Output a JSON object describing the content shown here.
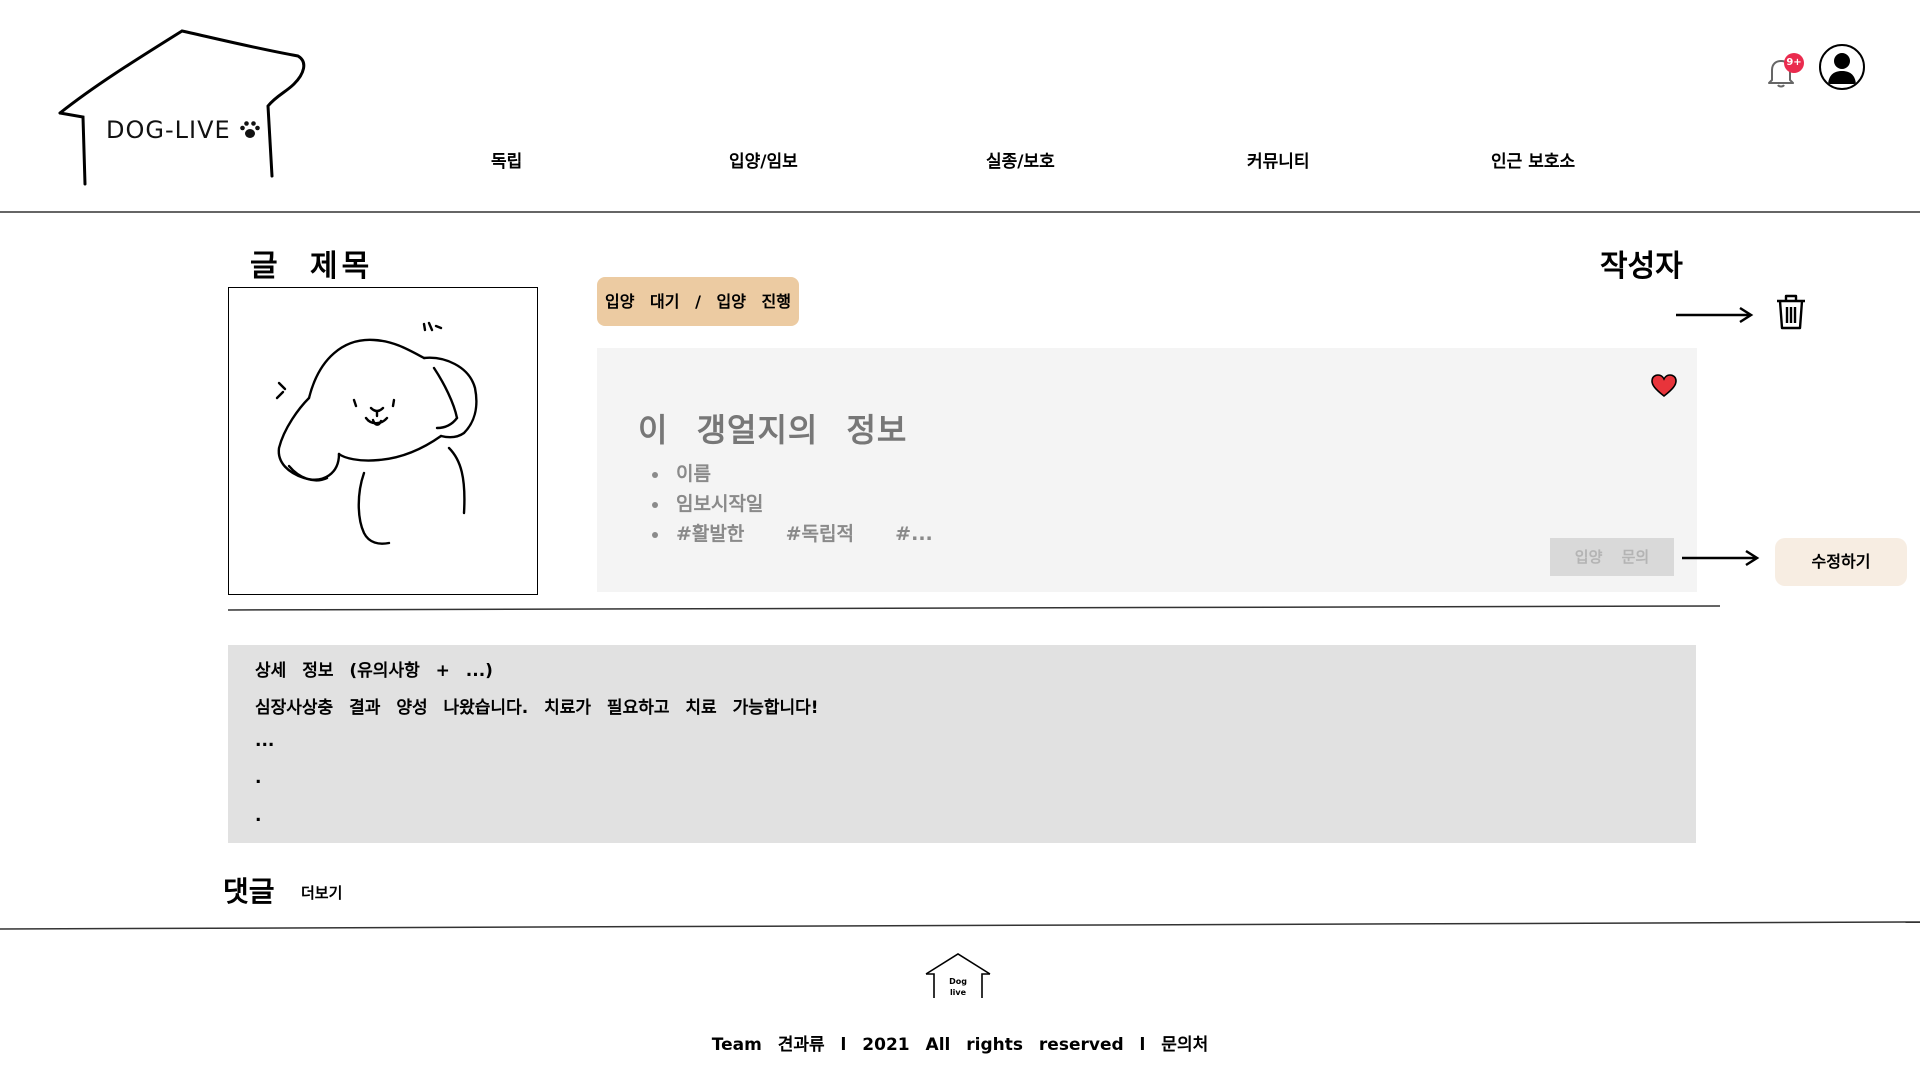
{
  "header": {
    "logo_text": "DOG-LIVE",
    "nav": [
      "독립",
      "입양/임보",
      "실종/보호",
      "커뮤니티",
      "인근 보호소"
    ],
    "notification_badge": "9+"
  },
  "post": {
    "title": "글 제목",
    "author": "작성자",
    "status": "입양 대기 / 입양 진행"
  },
  "info": {
    "heading": "이 갱얼지의 정보",
    "items": [
      "이름",
      "임보시작일",
      "#활발한  #독립적  #..."
    ],
    "inquiry_label": "입양 문의",
    "edit_label": "수정하기"
  },
  "detail": {
    "lines": [
      "상세 정보 (유의사항 + ...)",
      "심장사상충 결과 양성 나왔습니다. 치료가 필요하고 치료 가능합니다!",
      "...",
      ".",
      "."
    ]
  },
  "comments": {
    "label": "댓글",
    "more": "더보기"
  },
  "footer": {
    "logo_text_1": "Dog",
    "logo_text_2": "live",
    "text": "Team 견과류 l 2021 All rights reserved l 문의처"
  },
  "colors": {
    "status_badge": "#eccba2",
    "info_card": "#f4f4f4",
    "detail_box": "#e1e1e1",
    "edit_button": "#f7ede2",
    "heart": "#e8343b",
    "badge": "#ea2b4e"
  },
  "icons": [
    "paw-icon",
    "bell-icon",
    "user-icon",
    "trash-icon",
    "heart-icon",
    "arrow-right-icon"
  ]
}
